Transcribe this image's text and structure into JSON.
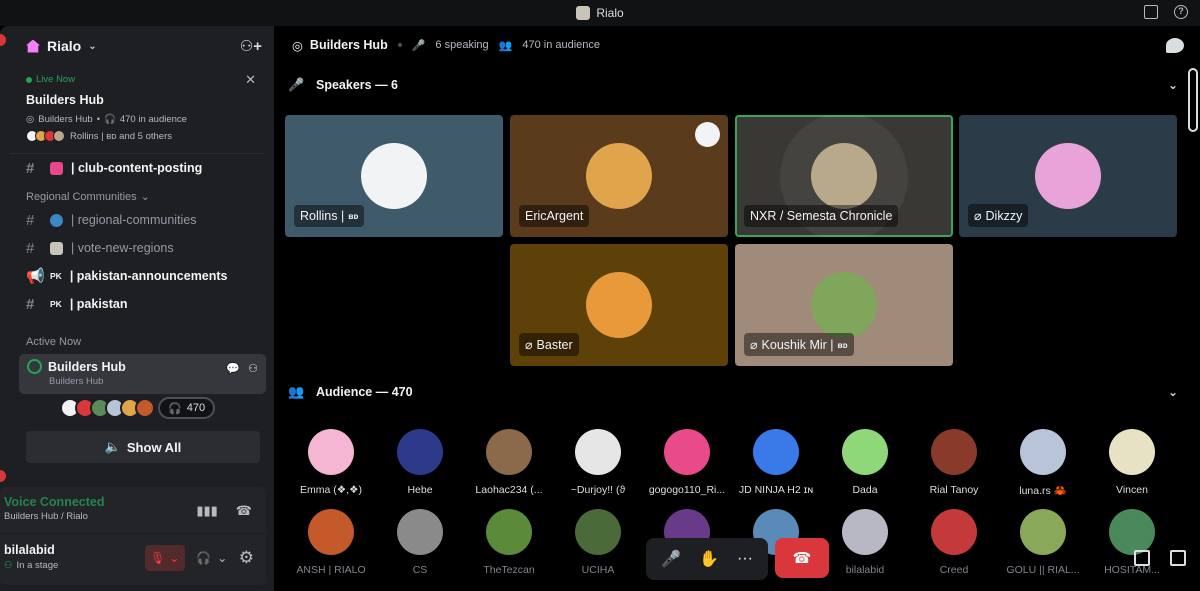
{
  "titlebar": {
    "app_name": "Rialo"
  },
  "sidebar": {
    "guild_name": "Rialo",
    "live": {
      "badge": "Live Now",
      "title": "Builders Hub",
      "meta_stage": "Builders Hub",
      "meta_audience": "470 in audience",
      "people": "Rollins | ʙᴅ and 5 others"
    },
    "channels": [
      {
        "label": "| club-content-posting",
        "bold": true,
        "emoji_color": "#e8488a"
      },
      {
        "category": "Regional Communities"
      },
      {
        "label": "| regional-communities",
        "bold": false,
        "emoji_color": "#3b88c3"
      },
      {
        "label": "| vote-new-regions",
        "bold": false,
        "emoji_color": "#c9c4b8"
      },
      {
        "label": "| pakistan-announcements",
        "bold": true,
        "flag": "PK"
      },
      {
        "label": "| pakistan",
        "bold": true,
        "flag": "PK"
      }
    ],
    "active_label": "Active Now",
    "active": {
      "title": "Builders Hub",
      "sub": "Builders Hub",
      "count": "470"
    },
    "show_all": "Show All",
    "voice": {
      "title": "Voice Connected",
      "sub": "Builders Hub / Rialo"
    },
    "user": {
      "name": "bilalabid",
      "status": "In a stage"
    }
  },
  "main": {
    "header": {
      "title": "Builders Hub",
      "speaking": "6 speaking",
      "audience": "470 in audience"
    },
    "speakers_heading": "Speakers — 6",
    "audience_heading": "Audience — 470",
    "speakers": [
      {
        "name": "Rollins |",
        "tag": "ʙᴅ",
        "bg": "#3e5a6b",
        "av": "#f2f3f5",
        "speaking": false,
        "muted": false
      },
      {
        "name": "EricArgent",
        "tag": "",
        "bg": "#5a3b1c",
        "av": "#e0a44a",
        "speaking": false,
        "muted": false
      },
      {
        "name": "NXR / Semesta Chronicle",
        "tag": "",
        "bg": "#3a3834",
        "av": "#b8a98a",
        "speaking": true,
        "muted": false
      },
      {
        "name": "Dikzzy",
        "tag": "",
        "bg": "#2b3b47",
        "av": "#e9a3d8",
        "speaking": false,
        "muted": true
      },
      {
        "name": "Baster",
        "tag": "",
        "bg": "#5e4108",
        "av": "#e89a3a",
        "speaking": false,
        "muted": true
      },
      {
        "name": "Koushik Mir |",
        "tag": "ʙᴅ",
        "bg": "#a08a7a",
        "av": "#7fa65a",
        "speaking": false,
        "muted": true
      }
    ],
    "audience": [
      {
        "name": "Emma (❖,❖)",
        "color": "#f4b6d2"
      },
      {
        "name": "Hebe",
        "color": "#2d3a8a"
      },
      {
        "name": "Laohac234 (...",
        "color": "#8a6a4a"
      },
      {
        "name": "~Durjoy!! (ϑ",
        "color": "#e6e6e6"
      },
      {
        "name": "gogogo110_Ri...",
        "color": "#e84a8a"
      },
      {
        "name": "JD NINJA H2 ɪɴ",
        "color": "#3a7ae8"
      },
      {
        "name": "Dada",
        "color": "#8ed87a"
      },
      {
        "name": "Rial Tanoy",
        "color": "#8a3a2a"
      },
      {
        "name": "luna.rs 🦀",
        "color": "#b8c4d8"
      },
      {
        "name": "Vincen",
        "color": "#e8e2c4"
      },
      {
        "name": "ANSH | RIALO",
        "color": "#c45a2a"
      },
      {
        "name": "CS",
        "color": "#8a8a8a"
      },
      {
        "name": "TheTezcan",
        "color": "#5a8a3a"
      },
      {
        "name": "UCIHA",
        "color": "#4a6a3a"
      },
      {
        "name": "",
        "color": "#6a3a8a"
      },
      {
        "name": "",
        "color": "#5a8ab8"
      },
      {
        "name": "bilalabid",
        "color": "#b8b8c4"
      },
      {
        "name": "Creed",
        "color": "#c43a3a"
      },
      {
        "name": "GOLU || RIAL...",
        "color": "#8aa85a"
      },
      {
        "name": "HOSITAM...",
        "color": "#4a8a5a"
      }
    ]
  }
}
